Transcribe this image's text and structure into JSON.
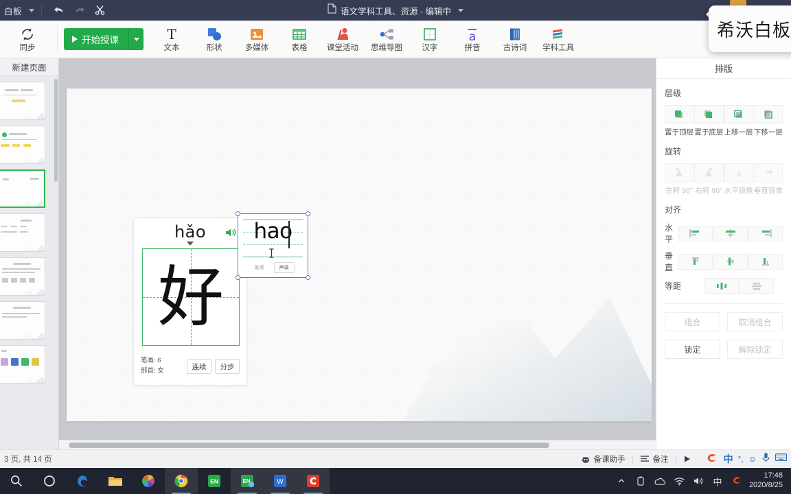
{
  "titlebar": {
    "app_name": "白板",
    "document_title": "语文学科工具、资源 - 编辑中",
    "icons": {
      "dropdown": "chevron-down-icon",
      "undo": "undo-icon",
      "redo": "redo-icon",
      "cut": "scissors-icon",
      "doc": "document-icon"
    }
  },
  "ribbon": {
    "sync": {
      "label": "同步",
      "icon": "sync-icon"
    },
    "start_class": {
      "label": "开始授课",
      "icon": "play-icon",
      "caret": "chevron-down-icon",
      "color": "#22ab4b"
    },
    "items": [
      {
        "label": "文本",
        "icon": "text-icon"
      },
      {
        "label": "形状",
        "icon": "shapes-icon"
      },
      {
        "label": "多媒体",
        "icon": "media-icon"
      },
      {
        "label": "表格",
        "icon": "table-icon"
      },
      {
        "label": "课堂活动",
        "icon": "classroom-activity-icon"
      },
      {
        "label": "思维导图",
        "icon": "mindmap-icon"
      },
      {
        "label": "汉字",
        "icon": "hanzi-grid-icon"
      },
      {
        "label": "拼音",
        "icon": "pinyin-icon"
      },
      {
        "label": "古诗词",
        "icon": "poetry-book-icon"
      },
      {
        "label": "学科工具",
        "icon": "subject-tools-icon"
      }
    ]
  },
  "left_panel": {
    "header": "新建页面",
    "selected_index": 2,
    "thumbnails": [
      {
        "name": "page-thumbnail-1"
      },
      {
        "name": "page-thumbnail-2"
      },
      {
        "name": "page-thumbnail-3"
      },
      {
        "name": "page-thumbnail-4"
      },
      {
        "name": "page-thumbnail-5"
      },
      {
        "name": "page-thumbnail-6"
      },
      {
        "name": "page-thumbnail-7"
      }
    ]
  },
  "canvas": {
    "hanzi_card": {
      "pinyin": "hǎo",
      "character": "好",
      "sound_icon": "speaker-icon",
      "caret_icon": "triangle-down-icon",
      "strokes_label": "笔画: 6",
      "radical_label": "部首: 女",
      "buttons": [
        {
          "label": "连续"
        },
        {
          "label": "分步"
        }
      ]
    },
    "pinyin_card": {
      "text": "hao",
      "selected": true,
      "buttons": [
        {
          "label": "笔顺",
          "style": "flat"
        },
        {
          "label": "声调",
          "style": "boxed"
        }
      ]
    }
  },
  "right_panel": {
    "header": "排版",
    "layer": {
      "title": "层级",
      "buttons": [
        {
          "label": "置于顶层",
          "icon": "bring-to-front-icon",
          "disabled": false
        },
        {
          "label": "置于底层",
          "icon": "send-to-back-icon",
          "disabled": false
        },
        {
          "label": "上移一层",
          "icon": "bring-forward-icon",
          "disabled": false
        },
        {
          "label": "下移一层",
          "icon": "send-backward-icon",
          "disabled": false
        }
      ]
    },
    "rotate": {
      "title": "旋转",
      "buttons": [
        {
          "label": "左转 90°",
          "icon": "rotate-left-icon",
          "disabled": true
        },
        {
          "label": "右转 90°",
          "icon": "rotate-right-icon",
          "disabled": true
        },
        {
          "label": "水平镜像",
          "icon": "flip-horizontal-icon",
          "disabled": true
        },
        {
          "label": "垂直镜像",
          "icon": "flip-vertical-icon",
          "disabled": true
        }
      ]
    },
    "align": {
      "title": "对齐",
      "rows": [
        {
          "label": "水平",
          "icons": [
            "align-left-icon",
            "align-center-icon",
            "align-right-icon"
          ]
        },
        {
          "label": "垂直",
          "icons": [
            "align-top-icon",
            "align-middle-icon",
            "align-bottom-icon"
          ]
        },
        {
          "label": "等距",
          "icons": [
            "distribute-horizontal-icon",
            "distribute-vertical-icon"
          ]
        }
      ]
    },
    "actions": [
      {
        "label": "组合",
        "disabled": true
      },
      {
        "label": "取消组合",
        "disabled": true
      },
      {
        "label": "锁定",
        "disabled": false
      },
      {
        "label": "解除锁定",
        "disabled": true
      }
    ]
  },
  "status_bar": {
    "pages": "3 页, 共 14 页",
    "items": [
      {
        "label": "备课助手",
        "icon": "assistant-icon"
      },
      {
        "label": "备注",
        "icon": "notes-icon"
      }
    ],
    "play_icon": "play-triangle-icon",
    "ime": {
      "sogou": "sogou-icon",
      "mode": "中",
      "punctuation": "°,",
      "emoji": "☺",
      "mic": "microphone-icon",
      "keyboard": "keyboard-icon"
    }
  },
  "taskbar": {
    "items": [
      {
        "name": "search-icon",
        "active": false
      },
      {
        "name": "cortana-icon",
        "active": false
      },
      {
        "name": "edge-icon",
        "active": false
      },
      {
        "name": "file-explorer-icon",
        "active": false
      },
      {
        "name": "photos-icon",
        "active": false
      },
      {
        "name": "chrome-icon",
        "active": true
      },
      {
        "name": "evernote-icon",
        "active": true
      },
      {
        "name": "seewo-icon",
        "active": true
      },
      {
        "name": "wps-icon",
        "active": true
      },
      {
        "name": "camtasia-icon",
        "active": true
      }
    ],
    "tray": {
      "chevron": "chevron-up-icon",
      "battery": "battery-icon",
      "onedrive": "onedrive-icon",
      "network": "wifi-icon",
      "volume": "volume-icon",
      "ime": "中",
      "sogou": "S"
    },
    "clock": {
      "time": "17:48",
      "date": "2020/8/25"
    }
  },
  "tooltip": {
    "text": "希沃白板"
  }
}
